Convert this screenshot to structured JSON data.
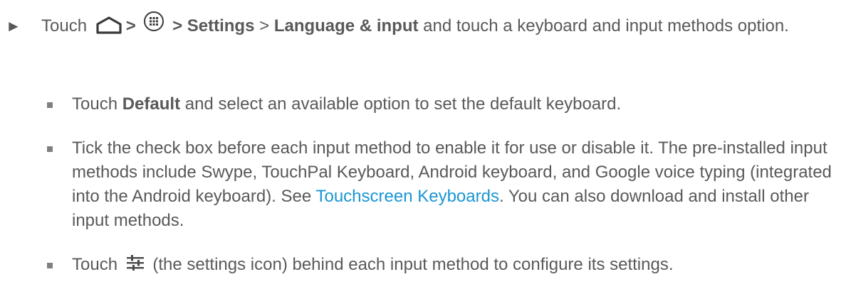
{
  "step": {
    "arrow": "►",
    "text_touch": "Touch",
    "text_gt1": ">",
    "text_gt2": ">",
    "settings_label": "Settings",
    "text_gt3": ">",
    "language_label": "Language & input",
    "text_rest": "and touch a keyboard and input methods option.",
    "icons": [
      "home-icon",
      "apps-icon"
    ]
  },
  "bullets": [
    {
      "pre": "Touch",
      "bold": "Default",
      "post": "and select an available option to set the default keyboard."
    },
    {
      "text": "Tick the check box before each input method to enable it for use or disable it. The pre-installed input methods include Swype, TouchPal Keyboard, Android keyboard, and Google voice typing (integrated into the Android keyboard). See",
      "link": "Touchscreen Keyboards",
      "post": ". You can also download and install other input methods."
    },
    {
      "pre": "Touch",
      "icon": "settings-tune-icon",
      "post": "(the settings icon) behind each input method to configure its settings."
    }
  ],
  "colors": {
    "text": "#595959",
    "link": "#1a96d4",
    "bullet": "#808080"
  }
}
